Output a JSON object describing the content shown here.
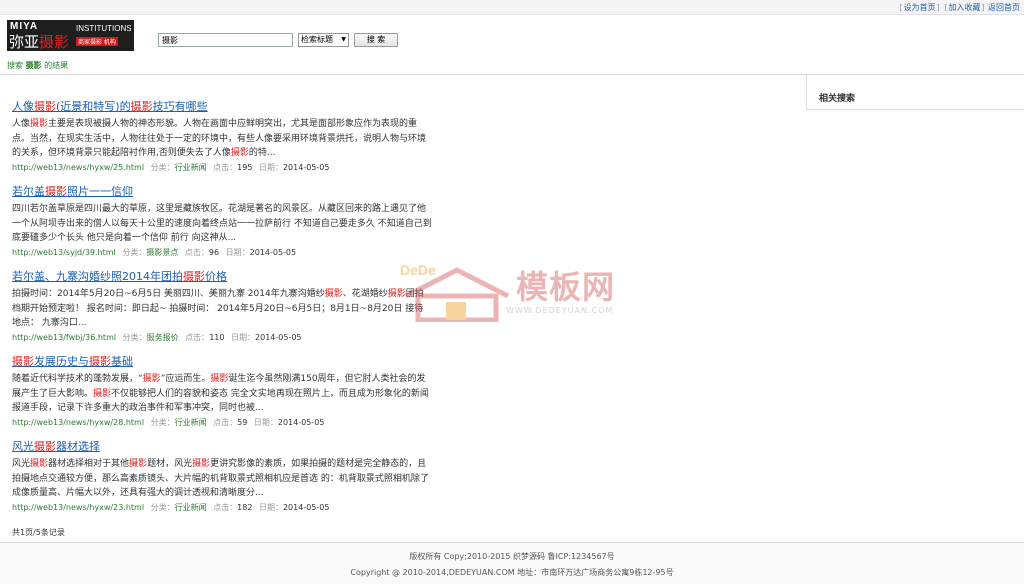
{
  "topbar": {
    "links": [
      "设为首页",
      "加入收藏",
      "返回首页"
    ]
  },
  "logo": {
    "line1": "MIYA",
    "line2_a": "弥亚",
    "line2_b": "摄影",
    "line3": "INSTITUTIONS",
    "line4": "商家摄影 机构"
  },
  "search": {
    "value": "摄影",
    "select_value": "检索标题",
    "button_label": "搜 索"
  },
  "crumb": {
    "prefix": "搜索",
    "keyword": "摄影",
    "suffix": "的结果"
  },
  "results": [
    {
      "title": [
        "人像",
        "摄影",
        "(近景和特写)的",
        "摄影",
        "技巧有哪些"
      ],
      "desc": [
        "人像",
        "摄影",
        "主要是表现被摄人物的神态形貌。人物在画面中应鲜明突出，尤其是面部形象应作为表现的重点。当然，在现实生活中，人物往往处于一定的环境中，有些人像要采用环境背景烘托，说明人物与环境的关系，但环境背景只能起陪衬作用,否则便失去了人像",
        "摄影",
        "的特..."
      ],
      "url": "http://web13/news/hyxw/25.html",
      "cat_label": "分类：",
      "cat": "行业新闻",
      "clicks_label": "点击：",
      "clicks": "195",
      "date_label": "日期：",
      "date": "2014-05-05"
    },
    {
      "title": [
        "若尔盖",
        "摄影",
        "照片一一信仰"
      ],
      "desc": [
        "四川若尔盖草原是四川最大的草原，这里是藏族牧区。花湖是著名的风景区。从藏区回来的路上遇见了他一个从阿坝寺出来的僧人以每天十公里的速度向着终点站一一拉萨前行 不知道自己要走多久 不知道自己到底要磕多少个长头 他只是向着一个信仰 前行 向这神从...",
        "",
        "",
        "",
        ""
      ],
      "url": "http://web13/syjd/39.html",
      "cat_label": "分类：",
      "cat": "摄影景点",
      "clicks_label": "点击：",
      "clicks": "96",
      "date_label": "日期：",
      "date": "2014-05-05"
    },
    {
      "title": [
        "若尔盖、九寨沟婚纱照2014年团拍",
        "摄影",
        "价格"
      ],
      "desc": [
        "拍摄时间：2014年5月20日~6月5日 美丽四川、美丽九寨 2014年九寨沟婚纱",
        "摄影",
        "、花湖婚纱",
        "摄影",
        "团拍档期开始预定啦！ 报名时间：即日起~ 拍摄时间： 2014年5月20日~6月5日；8月1日~8月20日 接待地点： 九寨沟口..."
      ],
      "url": "http://web13/fwbj/36.html",
      "cat_label": "分类：",
      "cat": "服务报价",
      "clicks_label": "点击：",
      "clicks": "110",
      "date_label": "日期：",
      "date": "2014-05-05"
    },
    {
      "title": [
        "摄影",
        "发展历史与",
        "摄影",
        "基础",
        ""
      ],
      "desc": [
        "随着近代科学技术的蓬勃发展，“",
        "摄影",
        "”应运而生。",
        "摄影",
        "诞生迄今虽然刚满150周年，但它肘人类社会的发展产生了巨大影响。",
        "摄影",
        "不仅能够把人们的容貌和姿态 完全文实地再现在照片上，而且成为形象化的新闻报道手段，记录下许多重大的政治事件和军事冲突，同时也被..."
      ],
      "url": "http://web13/news/hyxw/28.html",
      "cat_label": "分类：",
      "cat": "行业新闻",
      "clicks_label": "点击：",
      "clicks": "59",
      "date_label": "日期：",
      "date": "2014-05-05"
    },
    {
      "title": [
        "风光",
        "摄影",
        "器材选择"
      ],
      "desc": [
        "风光",
        "摄影",
        "器材选择相对于其他",
        "摄影",
        "题材，风光",
        "摄影",
        "更讲究影像的素质，如果拍摄的题材是完全静态的，且拍摄地点交通较方便，那么高素质镜头、大片幅的机背取景式照相机应是首选 的：机背取景式照相机除了成像质量高、片幅大以外，还具有强大的调计透视和清晰度分..."
      ],
      "url": "http://web13/news/hyxw/23.html",
      "cat_label": "分类：",
      "cat": "行业新闻",
      "clicks_label": "点击：",
      "clicks": "182",
      "date_label": "日期：",
      "date": "2014-05-05"
    }
  ],
  "pager": "共1页/5条记录",
  "side": {
    "title": "相关搜索"
  },
  "watermark": {
    "brand": "DeDe",
    "cn": "模板网",
    "url": "WWW.DEDEYUAN.COM"
  },
  "footer": {
    "line1": "版权所有 Copy;2010-2015 织梦源码 鲁ICP:1234567号",
    "line2": "Copyright @ 2010-2014,DEDEYUAN.COM 地址：市南环万达广场商务公寓9栋12-95号"
  },
  "colors": {
    "link": "#1a5fb4",
    "highlight": "#e02020",
    "meta_green": "#2e7d32"
  }
}
